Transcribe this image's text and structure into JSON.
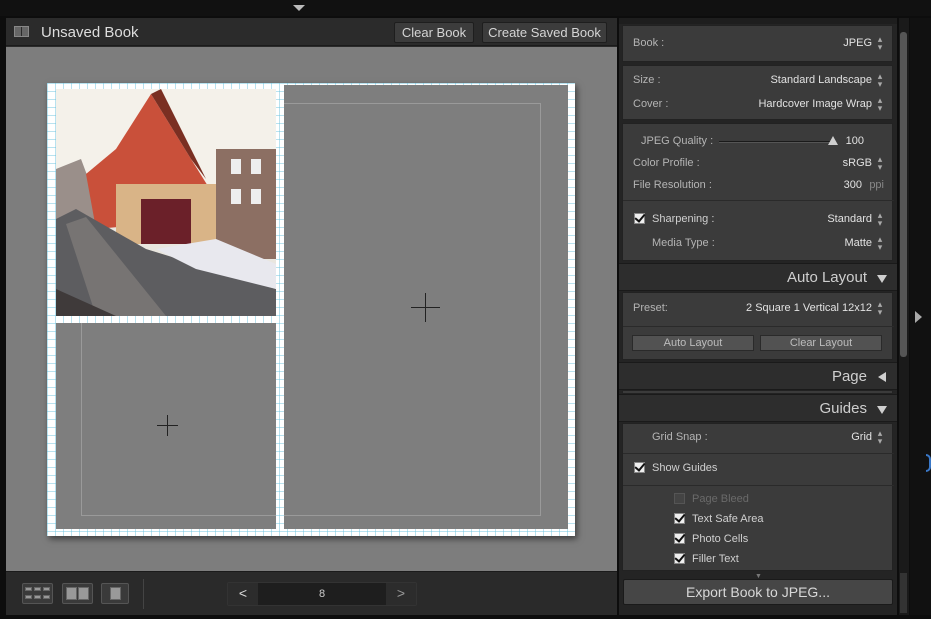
{
  "window": {
    "title": "Unsaved Book"
  },
  "toolbar": {
    "clear_book": "Clear Book",
    "create_saved_book": "Create Saved Book"
  },
  "filmstrip": {
    "page_number": "8",
    "prev": "<",
    "next": ">"
  },
  "book_settings": {
    "book": {
      "label": "Book :",
      "value": "JPEG"
    },
    "size": {
      "label": "Size :",
      "value": "Standard Landscape"
    },
    "cover": {
      "label": "Cover :",
      "value": "Hardcover Image Wrap"
    },
    "jpeg_quality": {
      "label": "JPEG Quality :",
      "value": "100",
      "level": 0.97
    },
    "color_profile": {
      "label": "Color Profile :",
      "value": "sRGB"
    },
    "file_resolution": {
      "label": "File Resolution :",
      "value": "300",
      "unit": "ppi"
    },
    "sharpening": {
      "label": "Sharpening :",
      "value": "Standard",
      "checked": true
    },
    "media_type": {
      "label": "Media Type :",
      "value": "Matte"
    }
  },
  "auto_layout": {
    "header": "Auto Layout",
    "preset_label": "Preset:",
    "preset_value": "2 Square 1 Vertical 12x12",
    "auto_layout_button": "Auto Layout",
    "clear_layout_button": "Clear Layout"
  },
  "page_section": {
    "header": "Page"
  },
  "guides": {
    "header": "Guides",
    "grid_snap_label": "Grid Snap :",
    "grid_snap_value": "Grid",
    "show_guides": {
      "label": "Show Guides",
      "checked": true
    },
    "page_bleed": {
      "label": "Page Bleed",
      "checked": false
    },
    "text_safe_area": {
      "label": "Text Safe Area",
      "checked": true
    },
    "photo_cells": {
      "label": "Photo Cells",
      "checked": true
    },
    "filler_text": {
      "label": "Filler Text",
      "checked": true
    }
  },
  "export_button": "Export Book to JPEG...",
  "colors": {
    "panel_bg": "#3b3b3b",
    "canvas_bg": "#7d7d7d",
    "guide_grid": "#64bedc"
  }
}
